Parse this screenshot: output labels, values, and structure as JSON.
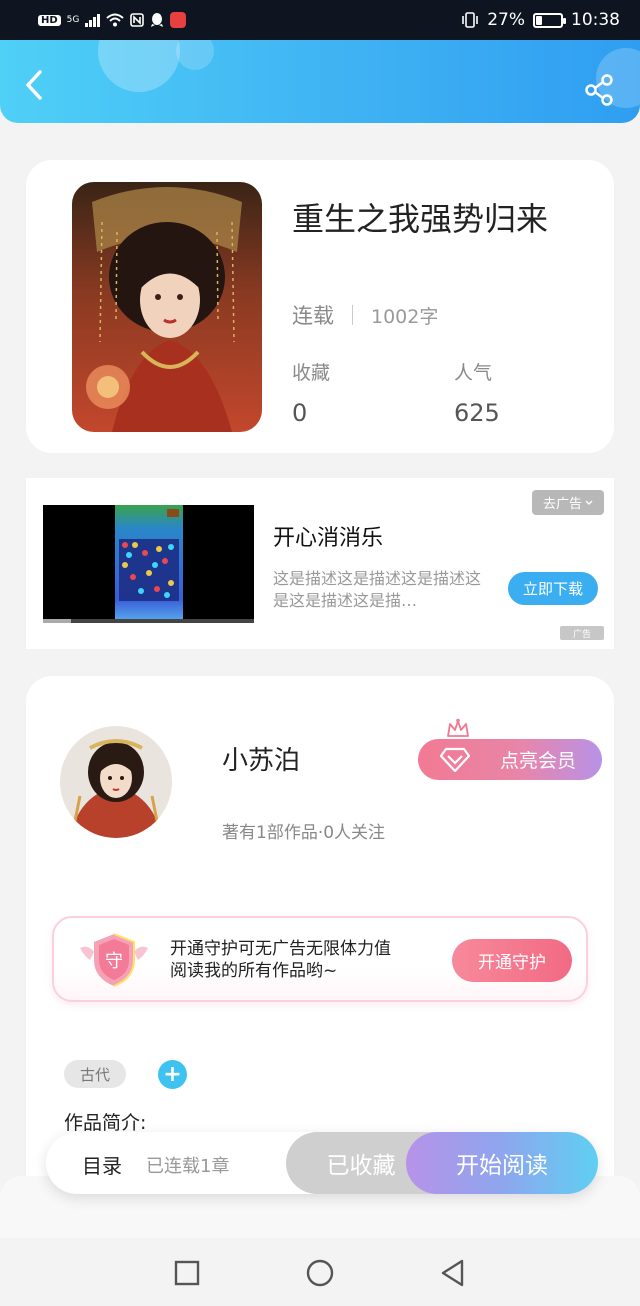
{
  "status_bar": {
    "hd": "HD",
    "net": "5G",
    "battery": "27%",
    "battery_level": 0.27,
    "time": "10:38"
  },
  "header": {
    "back_icon": "chevron-left-icon",
    "share_icon": "share-icon",
    "accent": "#3fb2f3"
  },
  "book": {
    "title": "重生之我强势归来",
    "status": "连载",
    "word_count": "1002字",
    "favorites_label": "收藏",
    "favorites": "0",
    "popularity_label": "人气",
    "popularity": "625"
  },
  "ad": {
    "close_label": "去广告",
    "title": "开心消消乐",
    "description": "这是描述这是描述这是描述这是这是描述这是描…",
    "download_label": "立即下载",
    "ad_mark": "广告"
  },
  "author": {
    "name": "小苏泊",
    "meta": "著有1部作品·0人关注",
    "vip_label": "点亮会员",
    "guard_badge": "守",
    "guard_text_line1": "开通守护可无广告无限体力值",
    "guard_text_line2": "阅读我的所有作品哟~",
    "guard_button": "开通守护"
  },
  "tags": [
    "古代"
  ],
  "tag_add": "+",
  "intro_label": "作品简介:",
  "action_bar": {
    "toc_label": "目录",
    "serial_label": "已连载1章",
    "collected_label": "已收藏",
    "read_label": "开始阅读"
  },
  "nav": [
    "recent-apps-icon",
    "home-icon",
    "back-icon"
  ]
}
